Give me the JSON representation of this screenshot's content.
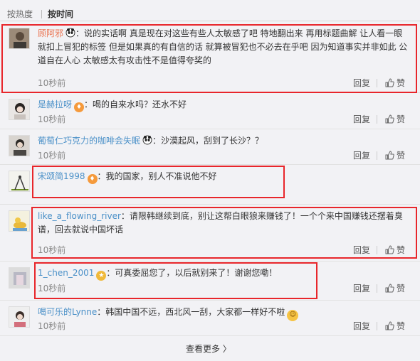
{
  "sort": {
    "tabs": [
      "按热度",
      "按时间"
    ],
    "active": 1
  },
  "comments": [
    {
      "user": "顾阿邪",
      "user_color": "#eb7350",
      "badge_icon": "panda-emoji",
      "text": "：说的实话啊 真是现在对这些有些人太敏感了吧 特地翻出来 再用标题曲解 让人看一眼就扣上冒犯的标签 但是如果真的有自信的话 就算被冒犯也不必去在乎吧 因为知道事实并非如此 公道自在人心 太敏感太有攻击性不是值得夸奖的",
      "time": "10秒前",
      "reply": "回复",
      "like": "赞"
    },
    {
      "user": "是赫拉呀",
      "user_color": "#4a90c8",
      "badge_icon": "fire-badge",
      "text": "：喝的自来水吗？还水不好",
      "time": "10秒前",
      "reply": "回复",
      "like": "赞"
    },
    {
      "user": "葡萄仁巧克力的咖啡会失眠",
      "user_color": "#4a90c8",
      "badge_icon": "panda-emoji",
      "text": "：沙漠起风，刮到了长沙？？",
      "time": "10秒前",
      "reply": "回复",
      "like": "赞"
    },
    {
      "user": "宋颂简1998",
      "user_color": "#4a90c8",
      "badge_icon": "fire-badge",
      "text": "：我的国家，别人不准说他不好",
      "time": "10秒前",
      "reply": "回复",
      "like": "赞"
    },
    {
      "user": "like_a_flowing_river",
      "user_color": "#4a90c8",
      "badge_icon": "",
      "text": "：请限韩继续到底，别让这帮白眼狼来赚钱了！一个个来中国赚钱还摆着臭谱，回去就说中国坏话",
      "time": "10秒前",
      "reply": "回复",
      "like": "赞"
    },
    {
      "user": "1_chen_2001",
      "user_color": "#4a90c8",
      "badge_icon": "gold-medal-badge",
      "text": "：可真委屈您了，以后就别来了！谢谢您嘞！",
      "time": "10秒前",
      "reply": "回复",
      "like": "赞"
    },
    {
      "user": "喝可乐的Lynne",
      "user_color": "#4a90c8",
      "badge_icon": "",
      "text": "：韩国中国不远，西北风一刮，大家都一样好不啦",
      "trailing_icon": "laughing-face-emoji",
      "time": "10秒前",
      "reply": "回复",
      "like": "赞"
    }
  ],
  "more": "查看更多 〉",
  "highlight_color": "#e8262b"
}
